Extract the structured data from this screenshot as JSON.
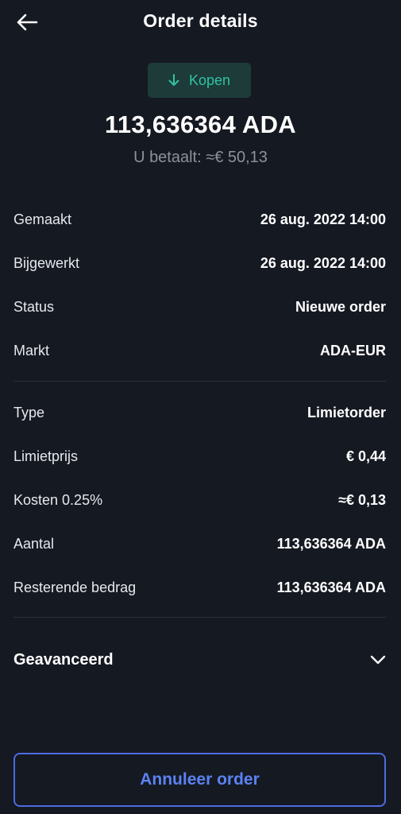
{
  "header": {
    "title": "Order details",
    "back_icon": "arrow-left-icon"
  },
  "order": {
    "side_label": "Kopen",
    "side_icon": "arrow-down-icon",
    "amount": "113,636364 ADA",
    "pay_line": "U betaalt: ≈€ 50,13"
  },
  "details_group_1": [
    {
      "label": "Gemaakt",
      "value": "26 aug. 2022 14:00"
    },
    {
      "label": "Bijgewerkt",
      "value": "26 aug. 2022 14:00"
    },
    {
      "label": "Status",
      "value": "Nieuwe order"
    },
    {
      "label": "Markt",
      "value": "ADA-EUR"
    }
  ],
  "details_group_2": [
    {
      "label": "Type",
      "value": "Limietorder"
    },
    {
      "label": "Limietprijs",
      "value": "€ 0,44"
    },
    {
      "label": "Kosten 0.25%",
      "value": "≈€ 0,13"
    },
    {
      "label": "Aantal",
      "value": "113,636364 ADA"
    },
    {
      "label": "Resterende bedrag",
      "value": "113,636364 ADA"
    }
  ],
  "advanced": {
    "label": "Geavanceerd",
    "icon": "chevron-down-icon"
  },
  "cancel_button": {
    "label": "Annuleer order"
  },
  "colors": {
    "background": "#151922",
    "buy_accent": "#2fc4a3",
    "buy_badge_bg": "#1d3b39",
    "button_blue": "#5b82f1",
    "muted_text": "#8d919b"
  }
}
